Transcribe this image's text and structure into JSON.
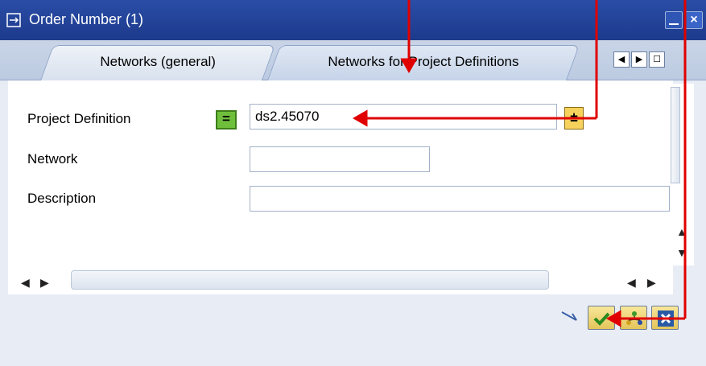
{
  "window": {
    "title": "Order Number (1)",
    "controls": [
      "minimize",
      "close"
    ]
  },
  "tabs": [
    {
      "label": "Networks (general)"
    },
    {
      "label": "Networks for Project Definitions"
    }
  ],
  "tab_nav": [
    "◀",
    "▶",
    "☐"
  ],
  "form": {
    "project_definition": {
      "label": "Project Definition",
      "value": "ds2.45070"
    },
    "network": {
      "label": "Network",
      "value": ""
    },
    "description": {
      "label": "Description",
      "value": ""
    }
  },
  "buttons": {
    "equals": "=",
    "f4": "±",
    "ok": "✔",
    "cancel": "✖"
  },
  "colors": {
    "title_bg": "#2a4da6",
    "tab_bg": "#c9d4e6",
    "content_bg": "#ffffff",
    "annotation": "#e00000"
  }
}
